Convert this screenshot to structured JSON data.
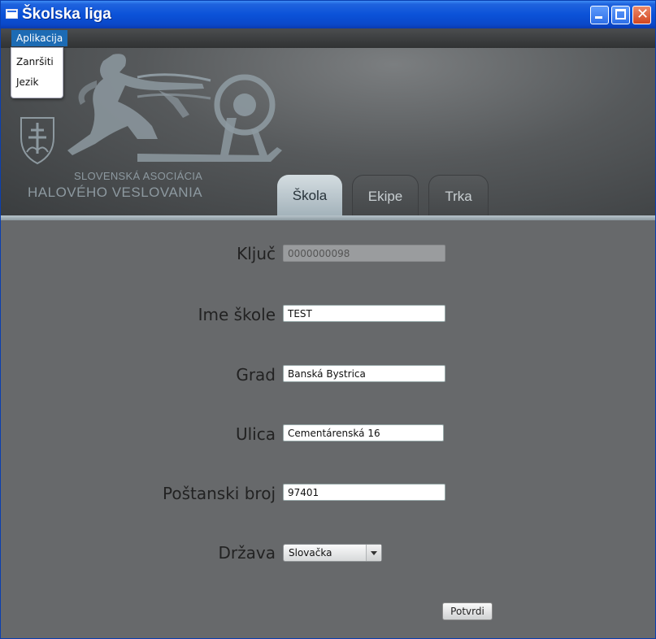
{
  "window": {
    "title": "Školska liga"
  },
  "menubar": {
    "items": [
      {
        "label": "Aplikacija"
      }
    ]
  },
  "menu_dropdown": {
    "items": [
      {
        "label": "Zanršiti"
      },
      {
        "label": "Jezik"
      }
    ]
  },
  "header": {
    "logo_line1": "SLOVENSKÁ ASOCIÁCIA",
    "logo_line2": "HALOVÉHO VESLOVANIA",
    "tabs": [
      {
        "label": "Škola",
        "active": true
      },
      {
        "label": "Ekipe",
        "active": false
      },
      {
        "label": "Trka",
        "active": false
      }
    ]
  },
  "form": {
    "fields": [
      {
        "label": "Ključ",
        "value": "0000000098",
        "readonly": true
      },
      {
        "label": "Ime škole",
        "value": "TEST"
      },
      {
        "label": "Grad",
        "value": "Banská Bystrica"
      },
      {
        "label": "Ulica",
        "value": "Cementárenská 16"
      },
      {
        "label": "Poštanski broj",
        "value": "97401"
      }
    ],
    "country": {
      "label": "Država",
      "selected": "Slovačka"
    },
    "submit_label": "Potvrdi"
  },
  "colors": {
    "titlebar": "#0b52d8",
    "menu_highlight": "#1d6bb4",
    "content_bg": "#67696b",
    "tab_active": "#b8c5cc"
  },
  "icons": {
    "window": "window-icon",
    "minimize": "minimize-icon",
    "maximize": "maximize-icon",
    "close": "close-icon",
    "logo": "rower-logo-icon",
    "crest": "double-cross-crest-icon",
    "select_arrow": "chevron-down-icon"
  }
}
